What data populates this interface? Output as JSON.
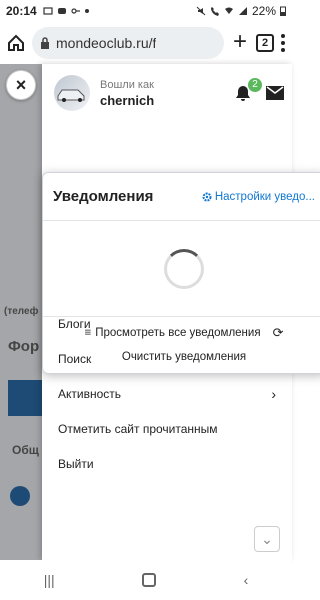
{
  "status_bar": {
    "time": "20:14",
    "battery": "22%"
  },
  "browser": {
    "url": "mondeoclub.ru/f",
    "tab_count": "2"
  },
  "background": {
    "strip_texts": [
      "(телеф",
      "Фор",
      "Общ"
    ]
  },
  "drawer": {
    "logged_in_as": "Вошли как",
    "username": "chernich",
    "badge_count": "2",
    "menu_items": [
      {
        "label": "Блоги"
      },
      {
        "label": "Поиск"
      },
      {
        "label": "Активность"
      },
      {
        "label": "Отметить сайт прочитанным"
      },
      {
        "label": "Выйти"
      }
    ]
  },
  "notifications": {
    "title": "Уведомления",
    "settings_label": "Настройки уведо...",
    "view_all_label": "Просмотреть все уведомления",
    "clear_label": "Очистить уведомления"
  },
  "close_label": "×"
}
